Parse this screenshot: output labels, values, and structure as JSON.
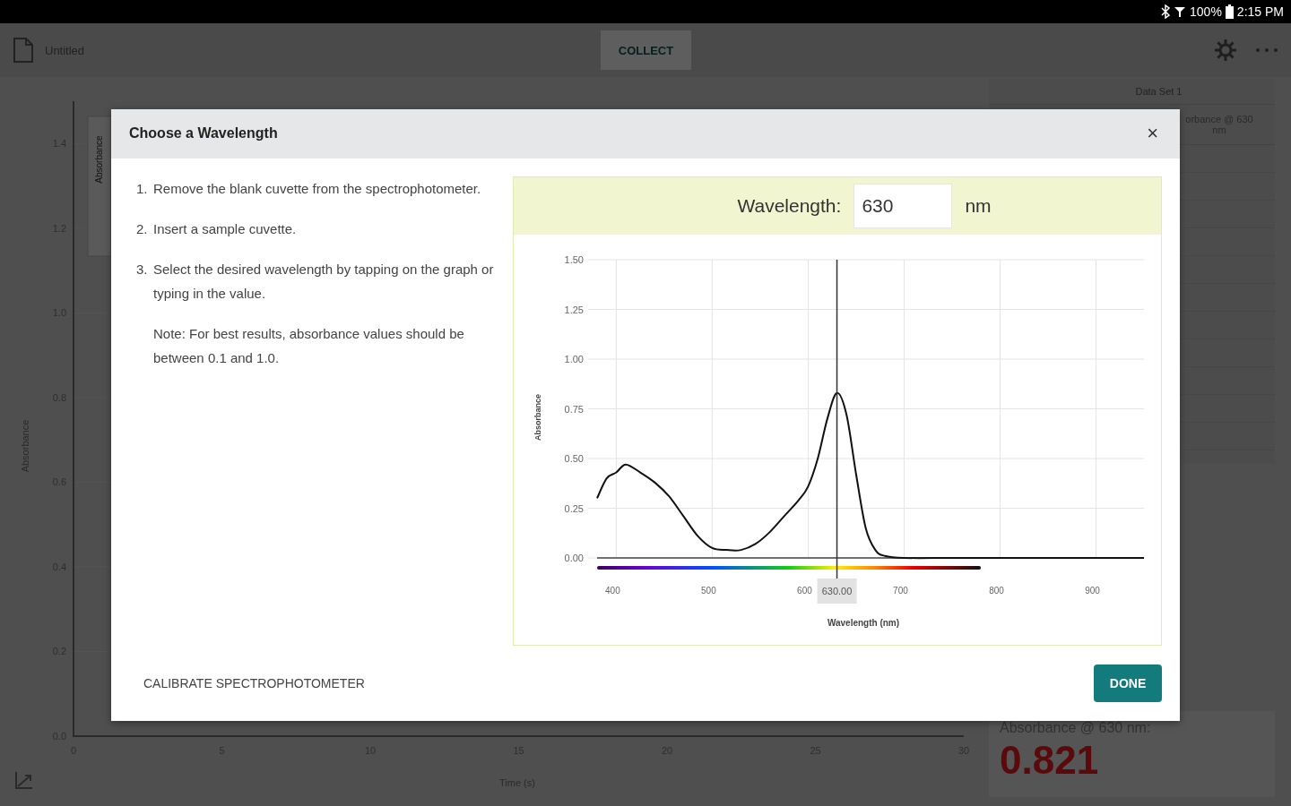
{
  "status_bar": {
    "battery": "100%",
    "time": "2:15 PM"
  },
  "app_bar": {
    "file_name": "Untitled",
    "collect_button": "COLLECT"
  },
  "graph": {
    "legend": "Absorbance",
    "chart_data": {
      "type": "line",
      "xlabel": "Time (s)",
      "ylabel": "Absorbance",
      "xlim": [
        0,
        30
      ],
      "ylim": [
        0,
        1.5
      ],
      "xticks": [
        0,
        5,
        10,
        15,
        20,
        25,
        30
      ],
      "yticks": [
        {
          "value": 0,
          "label": "0.0"
        },
        0.2,
        0.4,
        0.6,
        0.8,
        {
          "value": 1,
          "label": "1.0"
        },
        1.2,
        1.4
      ]
    }
  },
  "table": {
    "title": "Data Set 1",
    "column_header": "orbance @ 630 nm"
  },
  "meter": {
    "label": "Absorbance @ 630 nm:",
    "value": "0.821"
  },
  "dialog": {
    "title": "Choose a Wavelength",
    "close_button": "×",
    "steps": [
      {
        "number": "1.",
        "text": "Remove the blank cuvette from the spectrophotometer."
      },
      {
        "number": "2.",
        "text": "Insert a sample cuvette."
      },
      {
        "number": "3.",
        "text": "Select the desired wavelength by tapping on the graph or typing in the value."
      }
    ],
    "note": "Note: For best results, absorbance values should be between 0.1 and 1.0.",
    "wavelength": {
      "label": "Wavelength:",
      "value": "630",
      "unit": "nm"
    },
    "chart_data": {
      "type": "line",
      "xlabel": "Wavelength (nm)",
      "ylabel": "Absorbance",
      "xlim": [
        380,
        950
      ],
      "ylim": [
        0,
        1.5
      ],
      "grid": true,
      "xticks": [
        400,
        500,
        600,
        700,
        800,
        900
      ],
      "yticks": [
        {
          "value": 0,
          "label": "0.00"
        },
        0.25,
        {
          "value": 0.5,
          "label": "0.50"
        },
        0.75,
        {
          "value": 1,
          "label": "1.00"
        },
        1.25,
        {
          "value": 1.5,
          "label": "1.50"
        }
      ],
      "x": [
        380,
        390,
        400,
        410,
        425,
        440,
        455,
        470,
        485,
        500,
        515,
        530,
        545,
        560,
        575,
        590,
        600,
        610,
        620,
        630,
        640,
        650,
        660,
        670,
        680,
        700,
        750,
        800,
        850,
        900,
        950
      ],
      "series": [
        {
          "color": "#111111",
          "values": [
            0.3,
            0.4,
            0.43,
            0.47,
            0.43,
            0.38,
            0.31,
            0.21,
            0.11,
            0.05,
            0.04,
            0.04,
            0.07,
            0.13,
            0.21,
            0.29,
            0.36,
            0.5,
            0.7,
            0.83,
            0.72,
            0.42,
            0.15,
            0.04,
            0.01,
            0.0,
            0.0,
            0.0,
            0.0,
            0.0,
            0.0
          ]
        }
      ],
      "ref_lines": [
        {
          "axis": "x",
          "value": 630,
          "label": "630.00"
        }
      ]
    },
    "calibrate_button": "CALIBRATE SPECTROPHOTOMETER",
    "done_button": "DONE"
  }
}
